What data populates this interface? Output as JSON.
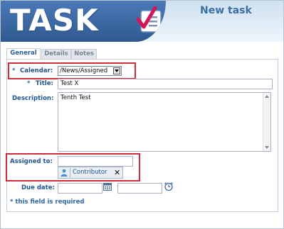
{
  "header": {
    "logo_text": "TASK",
    "title": "New task"
  },
  "tabs": [
    {
      "label": "General",
      "active": true
    },
    {
      "label": "Details",
      "active": false
    },
    {
      "label": "Notes",
      "active": false
    }
  ],
  "form": {
    "calendar": {
      "required_mark": "*",
      "label": "Calendar:",
      "value": "/News/Assigned"
    },
    "title": {
      "required_mark": "*",
      "label": "Title:",
      "value": "Test X"
    },
    "description": {
      "label": "Description:",
      "value": "Tenth Test"
    },
    "assigned_to": {
      "label": "Assigned to:",
      "value": "",
      "contributor": "Contributor"
    },
    "due_date": {
      "label": "Due date:",
      "date_value": "",
      "time_value": ""
    }
  },
  "required_note": "* this field is required",
  "colors": {
    "banner": "#3a679f",
    "highlight": "#d22b3a",
    "label": "#22558e"
  }
}
